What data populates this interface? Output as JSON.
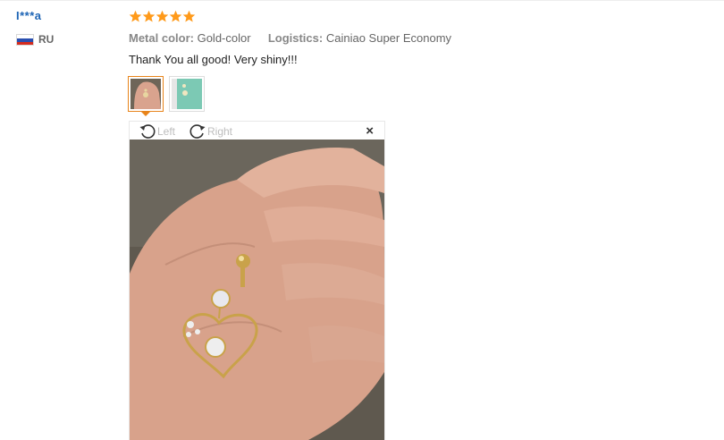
{
  "reviewer": {
    "name": "I***a",
    "country": "RU"
  },
  "review": {
    "rating": 5,
    "attributes": [
      {
        "key": "Metal color:",
        "value": "Gold-color"
      },
      {
        "key": "Logistics:",
        "value": "Cainiao Super Economy"
      }
    ],
    "text": "Thank You all good! Very shiny!!!"
  },
  "viewer": {
    "rotate_left_label": "Left",
    "rotate_right_label": "Right",
    "close_label": "×"
  },
  "colors": {
    "star": "#ff9a1a",
    "username": "#1d64b5",
    "thumb_active_border": "#e8841a"
  }
}
